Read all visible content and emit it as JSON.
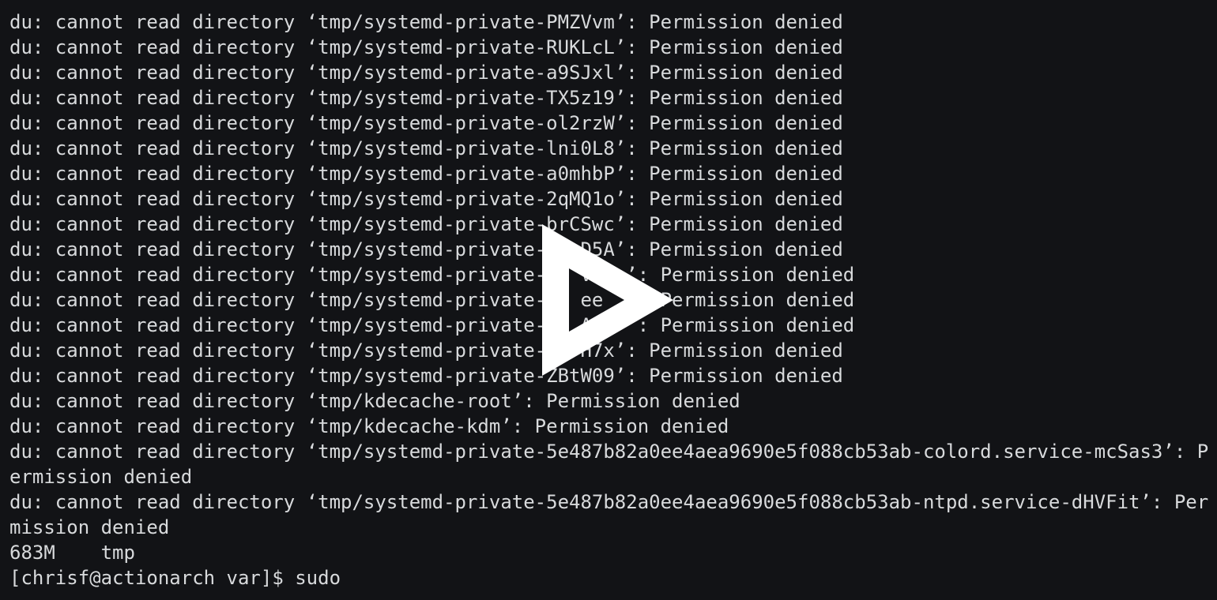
{
  "terminal": {
    "lines": [
      "du: cannot read directory ‘tmp/systemd-private-PMZVvm’: Permission denied",
      "du: cannot read directory ‘tmp/systemd-private-RUKLcL’: Permission denied",
      "du: cannot read directory ‘tmp/systemd-private-a9SJxl’: Permission denied",
      "du: cannot read directory ‘tmp/systemd-private-TX5z19’: Permission denied",
      "du: cannot read directory ‘tmp/systemd-private-ol2rzW’: Permission denied",
      "du: cannot read directory ‘tmp/systemd-private-lni0L8’: Permission denied",
      "du: cannot read directory ‘tmp/systemd-private-a0mhbP’: Permission denied",
      "du: cannot read directory ‘tmp/systemd-private-2qMQ1o’: Permission denied",
      "du: cannot read directory ‘tmp/systemd-private-brCSwc’: Permission denied",
      "du: cannot read directory ‘tmp/systemd-private-   D5A’: Permission denied",
      "du: cannot read directory ‘tmp/systemd-private-   V   ’: Permission denied",
      "du: cannot read directory ‘tmp/systemd-private-   ee  ’: Permission denied",
      "du: cannot read directory ‘tmp/systemd-private-   A   ’: Permission denied",
      "du: cannot read directory ‘tmp/systemd-private-   H7x’: Permission denied",
      "du: cannot read directory ‘tmp/systemd-private-ZBtW09’: Permission denied",
      "du: cannot read directory ‘tmp/kdecache-root’: Permission denied",
      "du: cannot read directory ‘tmp/kdecache-kdm’: Permission denied",
      "du: cannot read directory ‘tmp/systemd-private-5e487b82a0ee4aea9690e5f088cb53ab-colord.service-mcSas3’: P",
      "ermission denied",
      "du: cannot read directory ‘tmp/systemd-private-5e487b82a0ee4aea9690e5f088cb53ab-ntpd.service-dHVFit’: Per",
      "mission denied",
      "683M    tmp",
      "[chrisf@actionarch var]$ sudo"
    ]
  },
  "overlay": {
    "icon": "play-icon",
    "color": "#ffffff"
  },
  "colors": {
    "background": "#121316",
    "text": "#d8dadc"
  }
}
